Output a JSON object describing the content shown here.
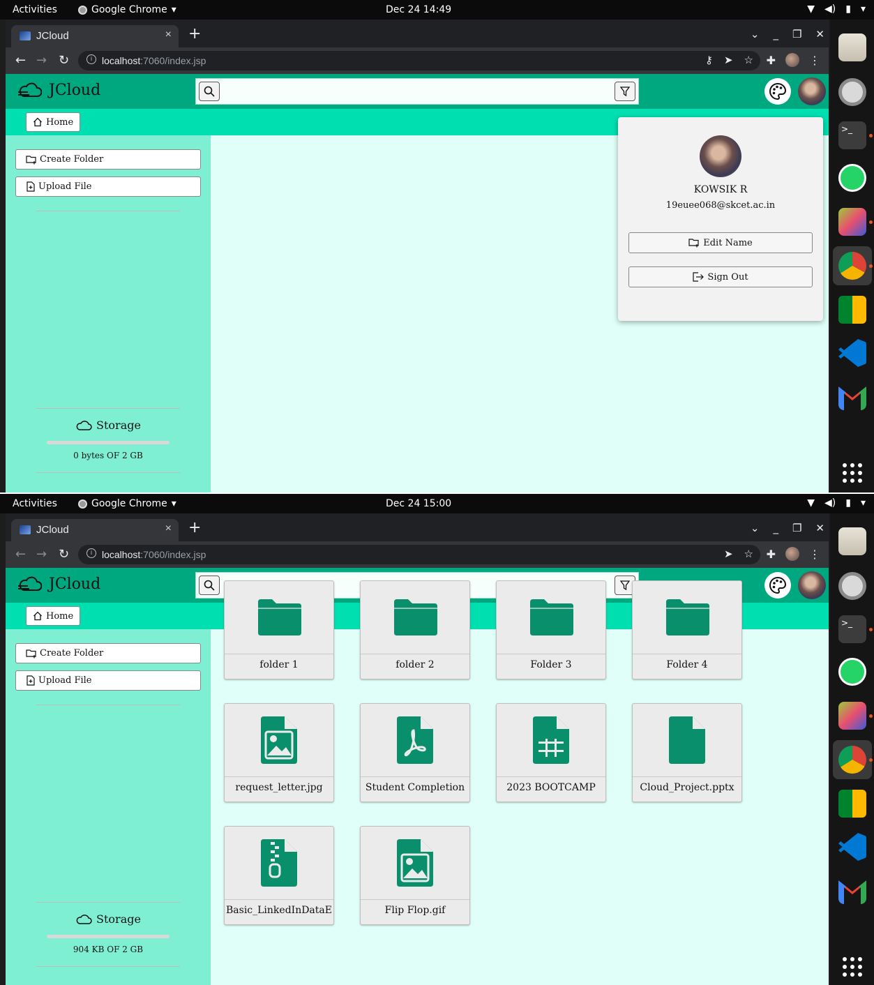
{
  "screens": [
    {
      "system": {
        "activities": "Activities",
        "app_name": "Google Chrome",
        "clock": "Dec 24  14:49"
      },
      "browser": {
        "tab_title": "JCloud",
        "url_host": "localhost",
        "url_path": ":7060/index.jsp",
        "back_enabled": true
      },
      "app": {
        "brand": "JCloud",
        "home_label": "Home",
        "create_folder_label": "Create Folder",
        "upload_file_label": "Upload File",
        "storage_label": "Storage",
        "storage_text": "0 bytes OF 2 GB",
        "storage_fraction": 0.0
      },
      "profile_popup": {
        "name": "KOWSIK R",
        "email": "19euee068@skcet.ac.in",
        "edit_name_label": "Edit Name",
        "sign_out_label": "Sign Out"
      },
      "items": []
    },
    {
      "system": {
        "activities": "Activities",
        "app_name": "Google Chrome",
        "clock": "Dec 24  15:00"
      },
      "browser": {
        "tab_title": "JCloud",
        "url_host": "localhost",
        "url_path": ":7060/index.jsp",
        "back_enabled": false
      },
      "app": {
        "brand": "JCloud",
        "home_label": "Home",
        "create_folder_label": "Create Folder",
        "upload_file_label": "Upload File",
        "storage_label": "Storage",
        "storage_text": "904 KB OF 2 GB",
        "storage_fraction": 0.0004
      },
      "profile_popup": null,
      "items": [
        {
          "label": "folder 1",
          "icon": "folder-icon"
        },
        {
          "label": "folder 2",
          "icon": "folder-icon"
        },
        {
          "label": "Folder 3",
          "icon": "folder-icon"
        },
        {
          "label": "Folder 4",
          "icon": "folder-icon"
        },
        {
          "label": "request_letter.jpg",
          "icon": "image-file-icon"
        },
        {
          "label": "Student Completion",
          "icon": "pdf-file-icon"
        },
        {
          "label": "2023 BOOTCAMP",
          "icon": "spreadsheet-file-icon"
        },
        {
          "label": "Cloud_Project.pptx",
          "icon": "file-icon"
        },
        {
          "label": "Basic_LinkedInDataE",
          "icon": "zip-file-icon"
        },
        {
          "label": "Flip Flop.gif",
          "icon": "image-file-icon"
        }
      ]
    }
  ],
  "colors": {
    "header": "#00a880",
    "breadcrumb_bar": "#00dfb0",
    "sidebar": "#7fefd3",
    "content_bg": "#e0fff8",
    "icon_green": "#0a8f6c"
  },
  "dock_icons": [
    "files-icon",
    "settings-icon",
    "terminal-icon",
    "whatsapp-icon",
    "virtualbox-icon",
    "chrome-icon",
    "google-meet-icon",
    "vscode-icon",
    "gmail-icon",
    "show-apps-icon"
  ]
}
